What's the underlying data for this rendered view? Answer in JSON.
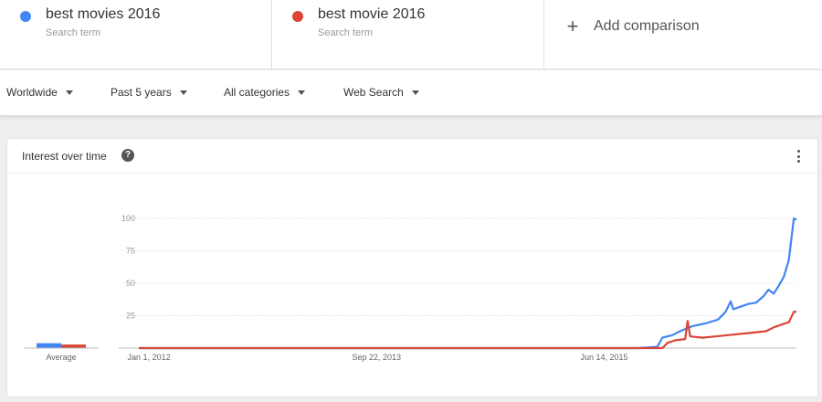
{
  "terms": [
    {
      "name": "best movies 2016",
      "sub": "Search term",
      "color": "#4285f4"
    },
    {
      "name": "best movie 2016",
      "sub": "Search term",
      "color": "#db4437"
    }
  ],
  "add_comparison": {
    "label": "Add comparison",
    "icon": "plus-icon"
  },
  "filters": {
    "region": "Worldwide",
    "time": "Past 5 years",
    "category": "All categories",
    "search_type": "Web Search"
  },
  "card": {
    "title": "Interest over time",
    "help_icon": "?",
    "menu_icon": "more-vert-icon"
  },
  "average": {
    "label": "Average"
  },
  "chart_data": {
    "type": "line",
    "ylim": [
      0,
      100
    ],
    "yticks": [
      "100",
      "75",
      "50",
      "25"
    ],
    "xticks": [
      {
        "date": "2012-01-01",
        "label": "Jan 1, 2012"
      },
      {
        "date": "2013-09-22",
        "label": "Sep 22, 2013"
      },
      {
        "date": "2015-06-14",
        "label": "Jun 14, 2015"
      }
    ],
    "x_range": [
      "2011-12-04",
      "2016-11-27"
    ],
    "averages": [
      3,
      2
    ],
    "series": [
      {
        "name": "best movies 2016",
        "color": "#4285f4",
        "points": [
          [
            "2011-12-04",
            0
          ],
          [
            "2015-09-15",
            0
          ],
          [
            "2015-11-08",
            1
          ],
          [
            "2015-11-22",
            8
          ],
          [
            "2015-12-20",
            10
          ],
          [
            "2016-01-10",
            13
          ],
          [
            "2016-02-14",
            17
          ],
          [
            "2016-03-20",
            19
          ],
          [
            "2016-04-24",
            22
          ],
          [
            "2016-05-15",
            28
          ],
          [
            "2016-05-29",
            36
          ],
          [
            "2016-06-05",
            30
          ],
          [
            "2016-06-26",
            32
          ],
          [
            "2016-07-17",
            34
          ],
          [
            "2016-08-07",
            35
          ],
          [
            "2016-08-28",
            40
          ],
          [
            "2016-09-11",
            45
          ],
          [
            "2016-09-25",
            42
          ],
          [
            "2016-10-09",
            48
          ],
          [
            "2016-10-23",
            55
          ],
          [
            "2016-11-06",
            68
          ],
          [
            "2016-11-20",
            100
          ],
          [
            "2016-11-27",
            99
          ]
        ]
      },
      {
        "name": "best movie 2016",
        "color": "#db4437",
        "points": [
          [
            "2011-12-04",
            0
          ],
          [
            "2015-11-22",
            0
          ],
          [
            "2015-12-06",
            4
          ],
          [
            "2015-12-27",
            6
          ],
          [
            "2016-01-24",
            7
          ],
          [
            "2016-01-31",
            21
          ],
          [
            "2016-02-07",
            9
          ],
          [
            "2016-03-13",
            8
          ],
          [
            "2016-04-17",
            9
          ],
          [
            "2016-05-22",
            10
          ],
          [
            "2016-06-26",
            11
          ],
          [
            "2016-07-31",
            12
          ],
          [
            "2016-09-04",
            13
          ],
          [
            "2016-09-25",
            16
          ],
          [
            "2016-10-16",
            18
          ],
          [
            "2016-11-06",
            20
          ],
          [
            "2016-11-20",
            28
          ],
          [
            "2016-11-27",
            28
          ]
        ]
      }
    ]
  }
}
